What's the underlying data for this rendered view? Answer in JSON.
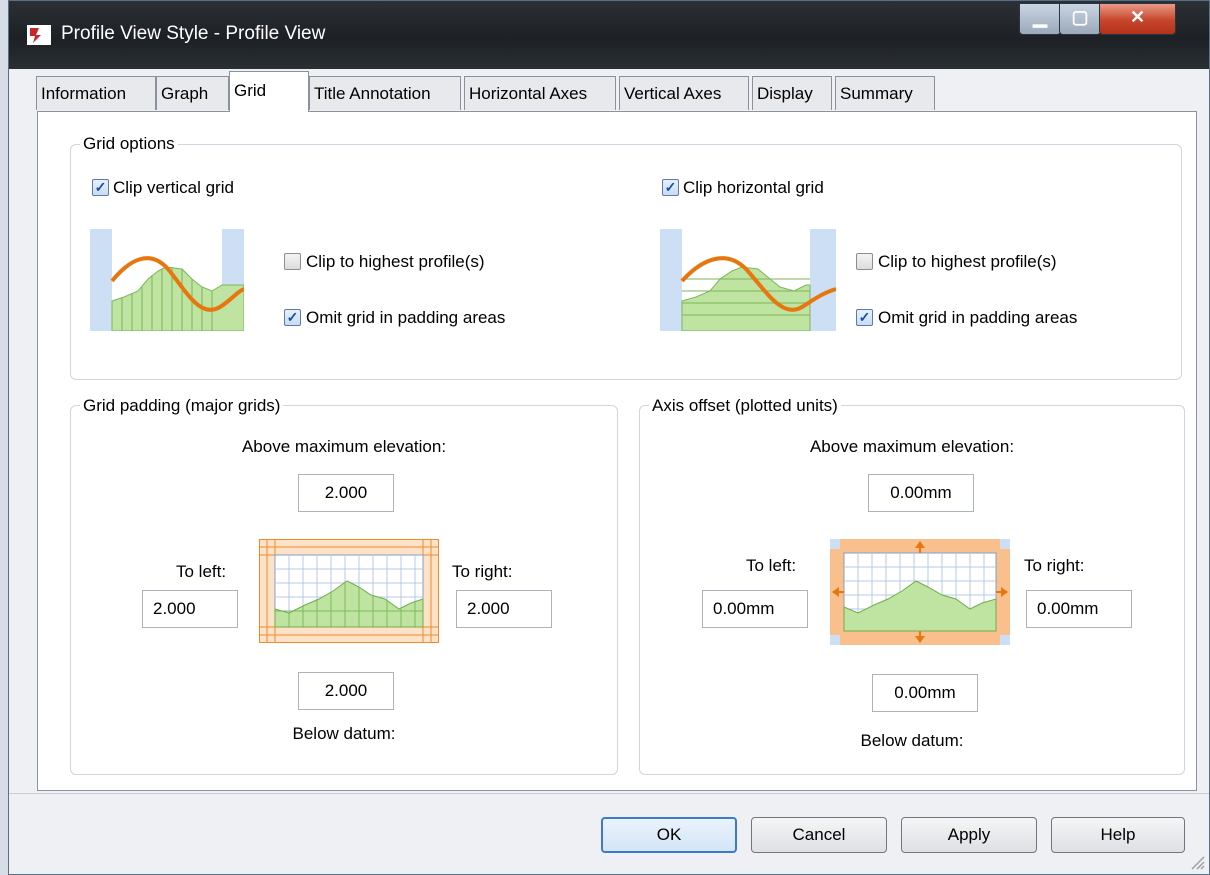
{
  "window": {
    "title": "Profile View Style - Profile View"
  },
  "tabs": [
    {
      "label": "Information"
    },
    {
      "label": "Graph"
    },
    {
      "label": "Grid"
    },
    {
      "label": "Title Annotation"
    },
    {
      "label": "Horizontal Axes"
    },
    {
      "label": "Vertical Axes"
    },
    {
      "label": "Display"
    },
    {
      "label": "Summary"
    }
  ],
  "active_tab": "Grid",
  "grid_options": {
    "title": "Grid options",
    "clip_vertical": {
      "label": "Clip vertical grid",
      "checked": true
    },
    "clip_horizontal": {
      "label": "Clip horizontal grid",
      "checked": true
    },
    "vertical_sub": {
      "clip_highest": {
        "label": "Clip to highest profile(s)",
        "checked": false
      },
      "omit_padding": {
        "label": "Omit grid in padding areas",
        "checked": true
      }
    },
    "horizontal_sub": {
      "clip_highest": {
        "label": "Clip to highest profile(s)",
        "checked": false
      },
      "omit_padding": {
        "label": "Omit grid in padding areas",
        "checked": true
      }
    }
  },
  "grid_padding": {
    "title": "Grid padding (major grids)",
    "above_label": "Above maximum elevation:",
    "above_value": "2.000",
    "left_label": "To left:",
    "left_value": "2.000",
    "right_label": "To right:",
    "right_value": "2.000",
    "below_value": "2.000",
    "below_label": "Below datum:"
  },
  "axis_offset": {
    "title": "Axis offset (plotted units)",
    "above_label": "Above maximum elevation:",
    "above_value": "0.00mm",
    "left_label": "To left:",
    "left_value": "0.00mm",
    "right_label": "To right:",
    "right_value": "0.00mm",
    "below_value": "0.00mm",
    "below_label": "Below datum:"
  },
  "buttons": {
    "ok": "OK",
    "cancel": "Cancel",
    "apply": "Apply",
    "help": "Help"
  },
  "colors": {
    "profile_line": "#e8760f",
    "ground_fill": "#bfe3a0",
    "padding": "#f7b57a",
    "panel_blue": "#cddff4"
  }
}
